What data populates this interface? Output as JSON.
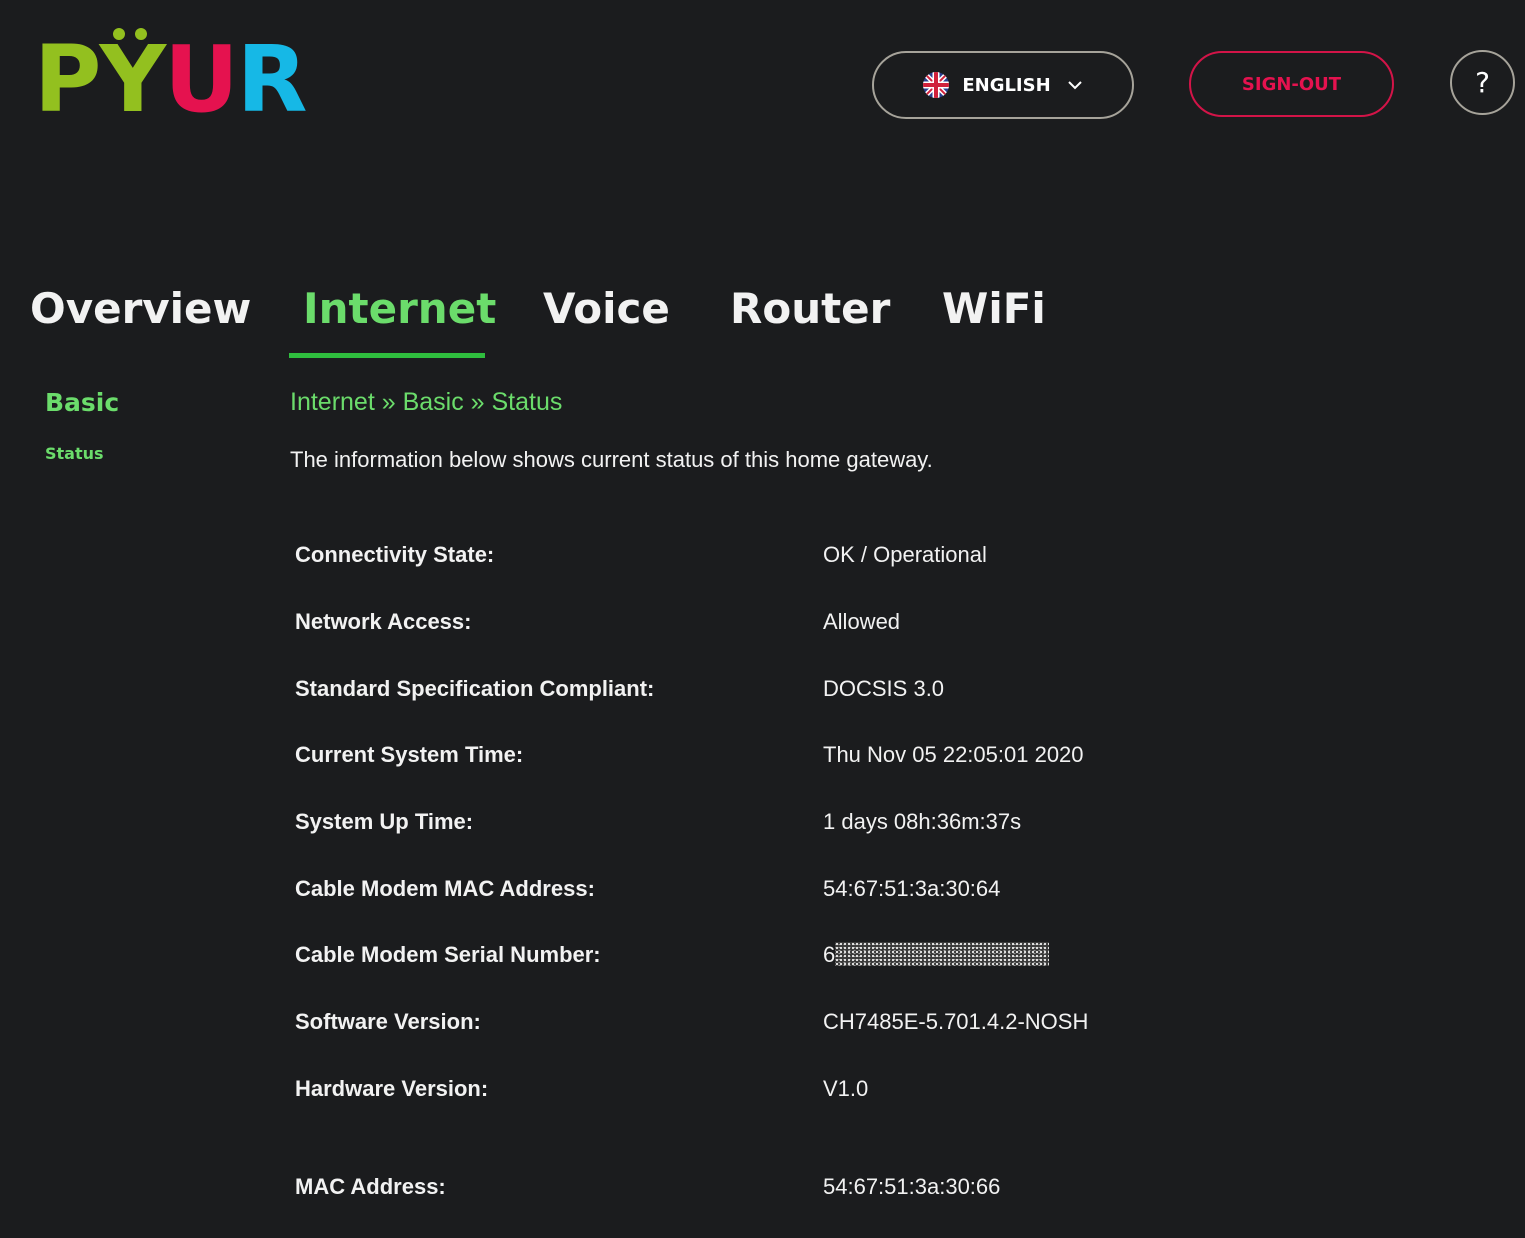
{
  "brand": {
    "logo_text": "PŸUR",
    "colors": {
      "green": "#93c01f",
      "magenta": "#e5124f",
      "cyan": "#16b8e6",
      "accent_green": "#6bdc6b",
      "background": "#1b1c1e"
    }
  },
  "header": {
    "language_label": "ENGLISH",
    "language_icon": "uk-flag-icon",
    "signout_label": "SIGN-OUT",
    "help_label": "?"
  },
  "tabs": [
    {
      "label": "Overview",
      "active": false
    },
    {
      "label": "Internet",
      "active": true
    },
    {
      "label": "Voice",
      "active": false
    },
    {
      "label": "Router",
      "active": false
    },
    {
      "label": "WiFi",
      "active": false
    }
  ],
  "sidebar": {
    "section": "Basic",
    "item": "Status"
  },
  "main": {
    "breadcrumb": "Internet » Basic » Status",
    "description": "The information below shows current status of this home gateway.",
    "rows": [
      {
        "label": "Connectivity State:",
        "value": "OK / Operational"
      },
      {
        "label": "Network Access:",
        "value": "Allowed"
      },
      {
        "label": "Standard Specification Compliant:",
        "value": "DOCSIS 3.0"
      },
      {
        "label": "Current System Time:",
        "value": "Thu Nov 05 22:05:01 2020"
      },
      {
        "label": "System Up Time:",
        "value": "1 days 08h:36m:37s"
      },
      {
        "label": "Cable Modem MAC Address:",
        "value": "54:67:51:3a:30:64"
      },
      {
        "label": "Cable Modem Serial Number:",
        "value": "6"
      },
      {
        "label": "Software Version:",
        "value": "CH7485E-5.701.4.2-NOSH"
      },
      {
        "label": "Hardware Version:",
        "value": "V1.0"
      },
      {
        "label": "MAC Address:",
        "value": "54:67:51:3a:30:66"
      }
    ]
  }
}
